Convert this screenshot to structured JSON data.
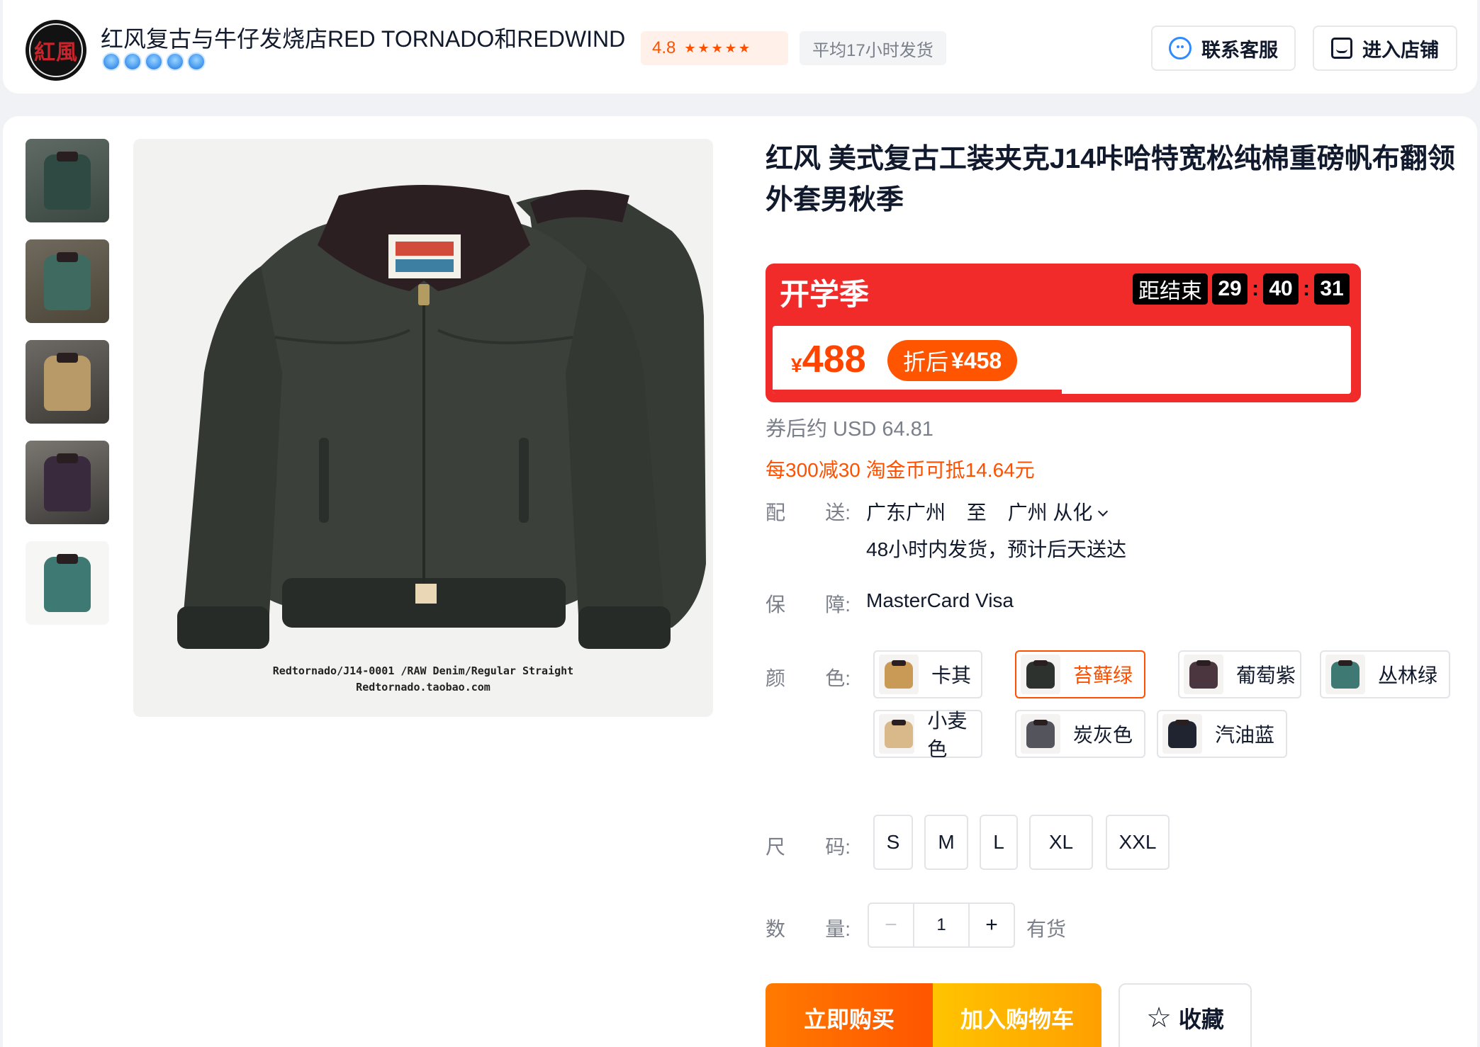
{
  "shop": {
    "name": "红风复古与牛仔发烧店RED TORNADO和REDWIND",
    "logo_text": "紅風",
    "rating": "4.8",
    "stars": "★★★★★",
    "avg_ship": "平均17小时发货",
    "service_label": "联系客服",
    "store_label": "进入店铺"
  },
  "product": {
    "title": "红风 美式复古工装夹克J14咔哈特宽松纯棉重磅帆布翻领外套男秋季",
    "image_caption_1": "Redtornado/J14-0001 /RAW Denim/Regular Straight",
    "image_caption_2": "Redtornado.taobao.com"
  },
  "promo": {
    "name": "开学季",
    "countdown_label": "距结束",
    "hours": "29",
    "minutes": "40",
    "seconds": "31",
    "progress_fraction": 0.5,
    "currency": "¥",
    "price": "488",
    "after_label": "折后",
    "after_price": "¥458"
  },
  "usd_note": "券后约 USD 64.81",
  "coupon_note": "每300减30 淘金币可抵14.64元",
  "shipping": {
    "label_a": "配",
    "label_b": "送:",
    "from": "广东广州",
    "to_word": "至",
    "to": "广州 从化",
    "eta": "48小时内发货，预计后天送达"
  },
  "guarantee": {
    "label_a": "保",
    "label_b": "障:",
    "value": "MasterCard Visa"
  },
  "color": {
    "label_a": "颜",
    "label_b": "色:",
    "options": [
      {
        "label": "卡其",
        "swatch": "#c99a55",
        "selected": false
      },
      {
        "label": "苔藓绿",
        "swatch": "#2e322e",
        "selected": true
      },
      {
        "label": "葡萄紫",
        "swatch": "#4b3640",
        "selected": false
      },
      {
        "label": "丛林绿",
        "swatch": "#3e7a73",
        "selected": false
      },
      {
        "label": "小麦色",
        "swatch": "#d9b88a",
        "selected": false
      },
      {
        "label": "炭灰色",
        "swatch": "#54555c",
        "selected": false
      },
      {
        "label": "汽油蓝",
        "swatch": "#1f2430",
        "selected": false
      }
    ]
  },
  "size": {
    "label_a": "尺",
    "label_b": "码:",
    "options": [
      "S",
      "M",
      "L",
      "XL",
      "XXL"
    ]
  },
  "quantity": {
    "label_a": "数",
    "label_b": "量:",
    "minus": "−",
    "value": "1",
    "plus": "+",
    "stock": "有货"
  },
  "actions": {
    "buy_now": "立即购买",
    "add_cart": "加入购物车",
    "favorite": "收藏"
  }
}
